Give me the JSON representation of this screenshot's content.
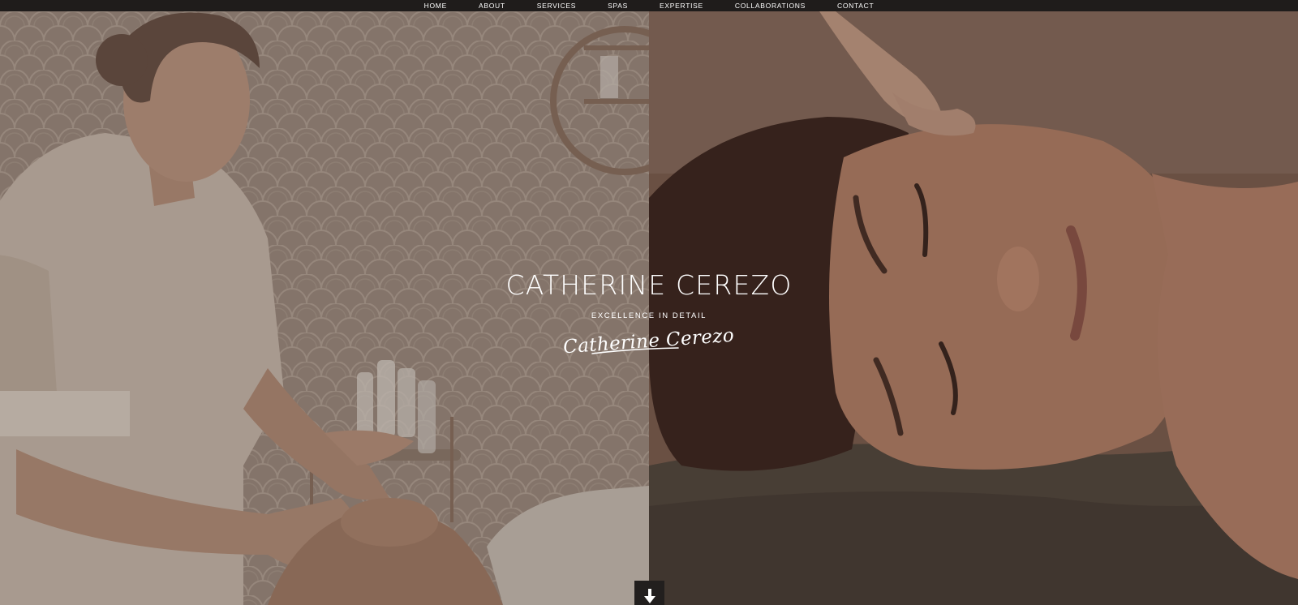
{
  "nav": {
    "items": [
      {
        "label": "HOME"
      },
      {
        "label": "ABOUT"
      },
      {
        "label": "SERVICES"
      },
      {
        "label": "SPAS"
      },
      {
        "label": "EXPERTISE"
      },
      {
        "label": "COLLABORATIONS"
      },
      {
        "label": "CONTACT"
      }
    ]
  },
  "hero": {
    "title": "CATHERINE CEREZO",
    "tagline": "EXCELLENCE IN DETAIL",
    "signature": "Catherine Cerezo",
    "scroll_icon": "arrow-down-icon"
  },
  "colors": {
    "nav_bg": "#1f1c1b",
    "text": "#ffffff",
    "button_bg": "#221f1e"
  }
}
